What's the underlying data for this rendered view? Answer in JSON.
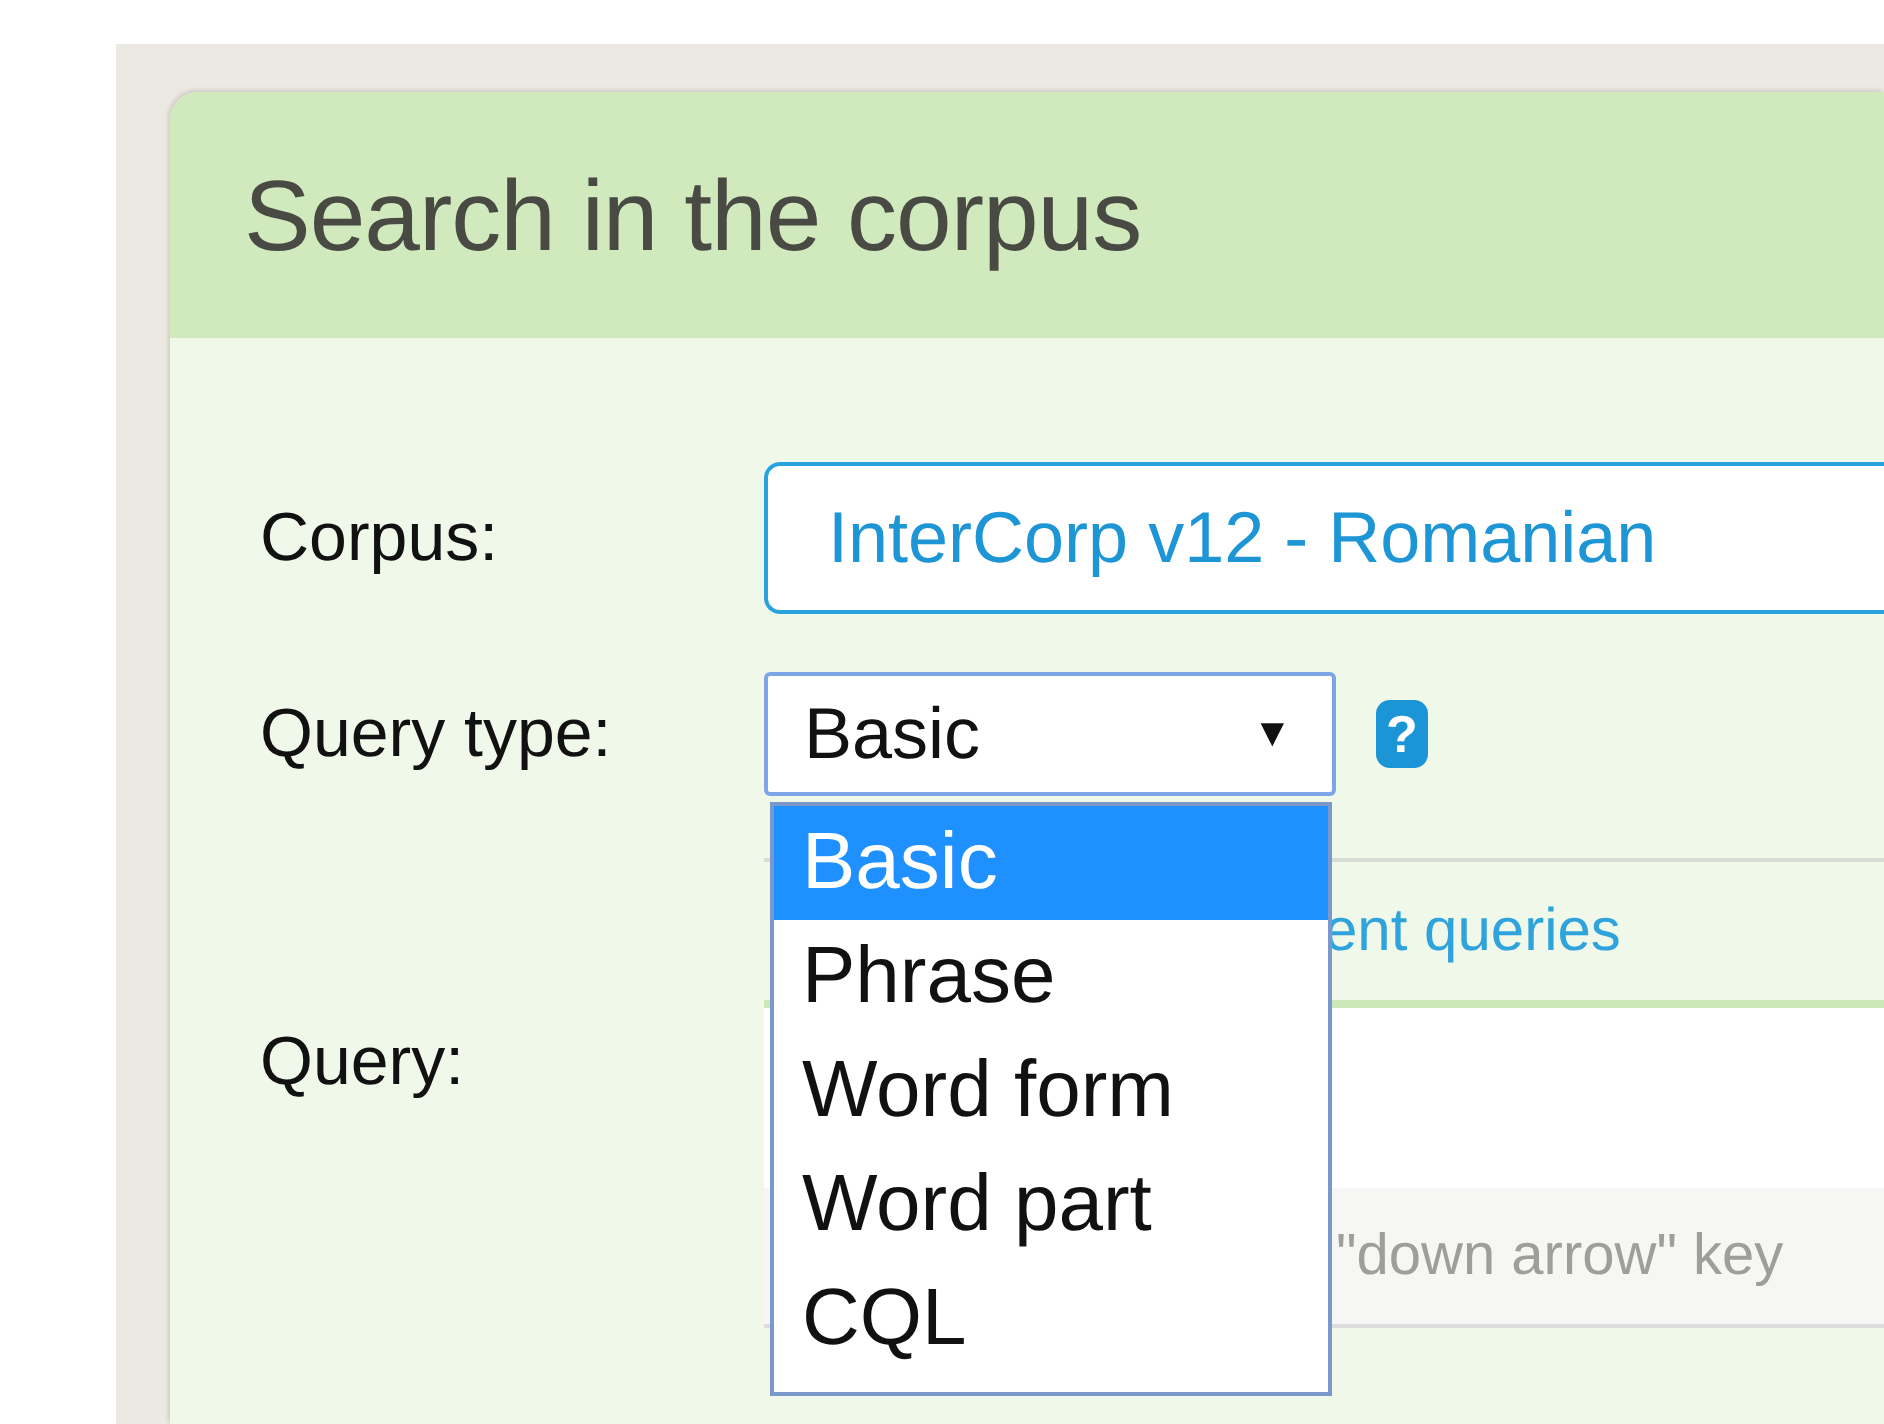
{
  "header": {
    "title": "Search in the corpus"
  },
  "corpus": {
    "label": "Corpus:",
    "value": "InterCorp v12 - Romanian"
  },
  "query_type": {
    "label": "Query type:",
    "value": "Basic",
    "arrow": "▼",
    "help": "?",
    "expanded": true,
    "options": [
      {
        "label": "Basic",
        "selected": true
      },
      {
        "label": "Phrase",
        "selected": false
      },
      {
        "label": "Word form",
        "selected": false
      },
      {
        "label": "Word part",
        "selected": false
      },
      {
        "label": "CQL",
        "selected": false
      }
    ]
  },
  "query": {
    "label": "Query:",
    "tab_link": "ent queries",
    "hint": "\"down arrow\" key"
  }
}
